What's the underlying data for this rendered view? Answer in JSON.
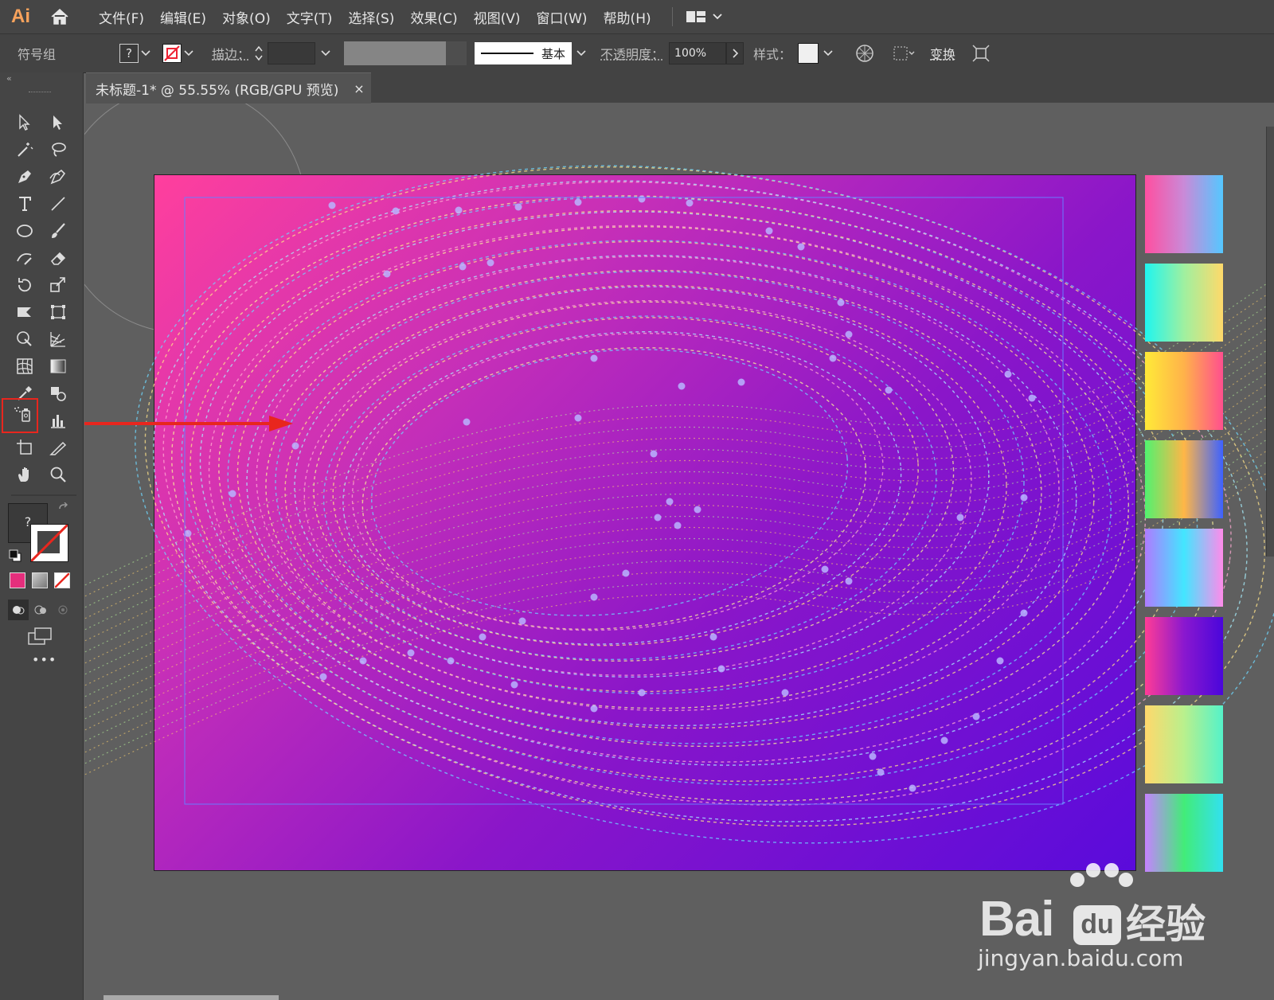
{
  "app": {
    "logo": "Ai"
  },
  "menubar": {
    "items": [
      "文件(F)",
      "编辑(E)",
      "对象(O)",
      "文字(T)",
      "选择(S)",
      "效果(C)",
      "视图(V)",
      "窗口(W)",
      "帮助(H)"
    ]
  },
  "controlbar": {
    "context_label": "符号组",
    "fill_value": "?",
    "stroke_label": "描边：",
    "stroke_profile_label": "基本",
    "opacity_label": "不透明度：",
    "opacity_value": "100%",
    "style_label": "样式：",
    "transform_label": "变换"
  },
  "tab": {
    "title": "未标题-1* @ 55.55% (RGB/GPU 预览)",
    "close": "×"
  },
  "toolbar": {
    "fill_stroke_value": "?",
    "more": "•••",
    "highlighted_tool": "symbol-sprayer-tool"
  },
  "swatches": [
    [
      "#ff4fa0",
      "#c98ad8",
      "#55c7ff"
    ],
    [
      "#1ff5ef",
      "#9ff0a0",
      "#ffd96a"
    ],
    [
      "#ffea38",
      "#ffb24a",
      "#ff4f8e"
    ],
    [
      "#51f26f",
      "#ffb647",
      "#3d62ff"
    ],
    [
      "#ae7bff",
      "#43e6ff",
      "#ff8bea"
    ],
    [
      "#ff3c96",
      "#8a18cf",
      "#4a06db"
    ],
    [
      "#ffd86c",
      "#b9f08d",
      "#55f2c9"
    ],
    [
      "#c582ff",
      "#42ec78",
      "#32e1f0"
    ]
  ],
  "colors": {
    "accent_highlight": "#e8261e",
    "logo": "#f7a25c",
    "fill_swatch": "#e52e7c"
  },
  "watermark": {
    "brand": "Bai",
    "brand_cn": "经验",
    "url": "jingyan.baidu.com"
  }
}
